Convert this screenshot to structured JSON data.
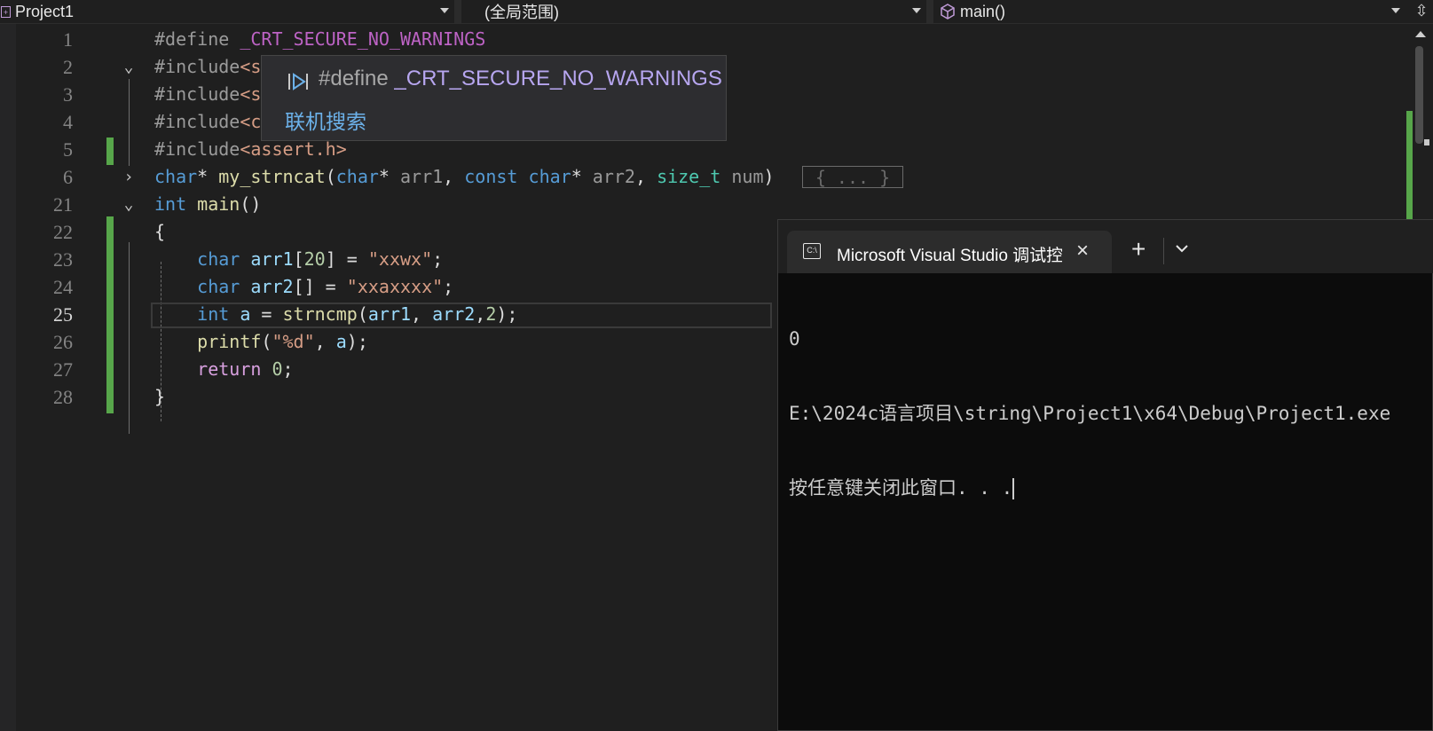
{
  "navbar": {
    "project": "Project1",
    "scope": "(全局范围)",
    "function": "main()",
    "project_icon": "project-icon",
    "function_icon": "cube-icon",
    "split_icon": "split-editor-icon"
  },
  "editor": {
    "lines": [
      {
        "num": "1"
      },
      {
        "num": "2"
      },
      {
        "num": "3"
      },
      {
        "num": "4"
      },
      {
        "num": "5"
      },
      {
        "num": "6"
      },
      {
        "num": "21"
      },
      {
        "num": "22"
      },
      {
        "num": "23"
      },
      {
        "num": "24"
      },
      {
        "num": "25"
      },
      {
        "num": "26"
      },
      {
        "num": "27"
      },
      {
        "num": "28"
      }
    ],
    "active_line": "25",
    "collapsed_placeholder": "{ ... }",
    "colors": {
      "keyword": "#569cd6",
      "control": "#d8a0df",
      "string": "#d69d85",
      "change_bar": "#57a64a"
    }
  },
  "tooltip": {
    "directive": "#define",
    "macro": "_CRT_SECURE_NO_WARNINGS",
    "link": "联机搜索"
  },
  "terminal": {
    "tab_title": "Microsoft Visual Studio 调试控制台",
    "output": [
      "0",
      "E:\\2024c语言项目\\string\\Project1\\x64\\Debug\\Project1.exe",
      "按任意键关闭此窗口. . ."
    ]
  }
}
